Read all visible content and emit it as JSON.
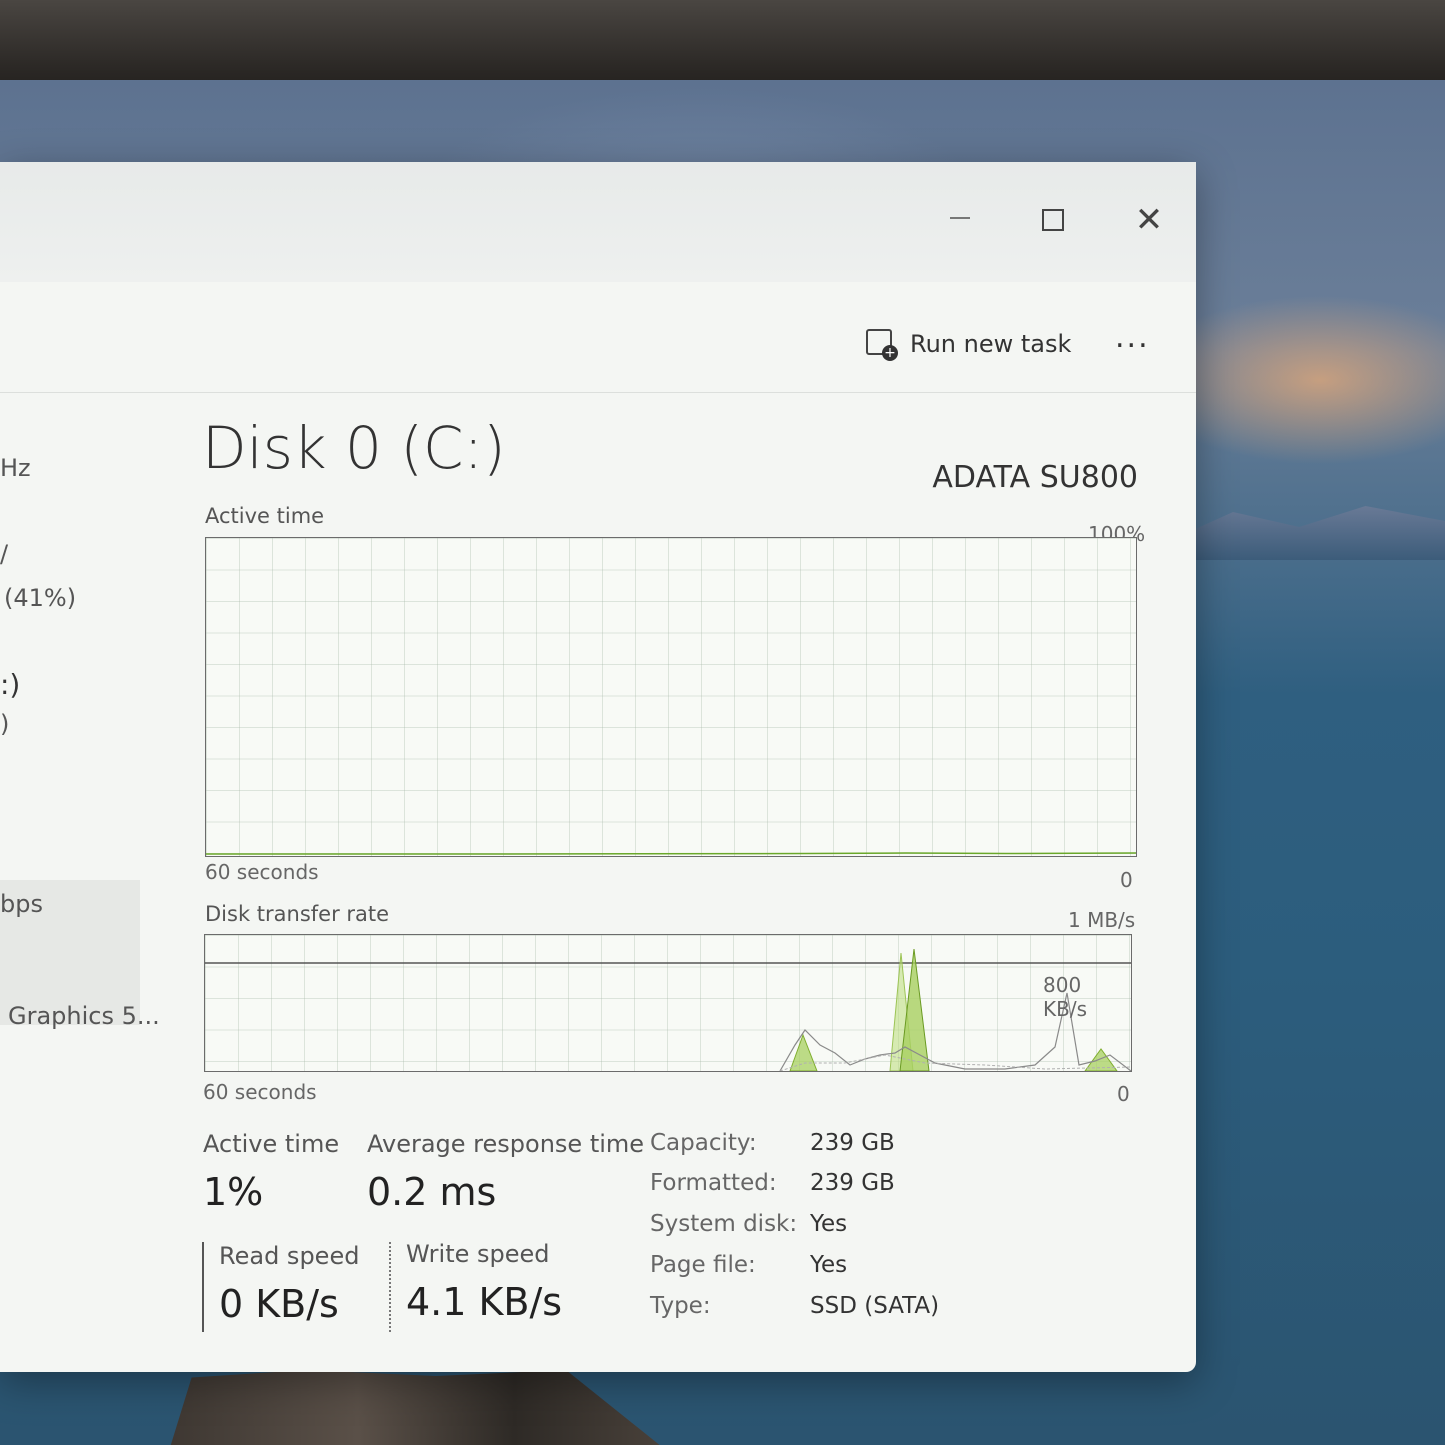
{
  "window": {
    "toolbar": {
      "run_new_task": "Run new task",
      "more": "..."
    }
  },
  "sidebar": {
    "items": [
      {
        "line1": "Hz"
      },
      {
        "line1": "/",
        "line2": "(41%)"
      },
      {
        "line1": ":)",
        "line2": ")",
        "selected": true
      },
      {
        "line1": "bps"
      },
      {
        "line1": "Graphics 5..."
      }
    ]
  },
  "disk": {
    "title": "Disk 0 (C:)",
    "model": "ADATA SU800",
    "active_time_graph": {
      "label": "Active time",
      "max_label": "100%",
      "time_label": "60 seconds",
      "min_label": "0"
    },
    "transfer_graph": {
      "label": "Disk transfer rate",
      "max_label": "1 MB/s",
      "mid_label": "800 KB/s",
      "time_label": "60 seconds",
      "min_label": "0"
    },
    "stats": {
      "active_time_label": "Active time",
      "active_time_value": "1%",
      "avg_response_label": "Average response time",
      "avg_response_value": "0.2 ms",
      "read_speed_label": "Read speed",
      "read_speed_value": "0 KB/s",
      "write_speed_label": "Write speed",
      "write_speed_value": "4.1 KB/s"
    },
    "properties": [
      {
        "key": "Capacity:",
        "value": "239 GB"
      },
      {
        "key": "Formatted:",
        "value": "239 GB"
      },
      {
        "key": "System disk:",
        "value": "Yes"
      },
      {
        "key": "Page file:",
        "value": "Yes"
      },
      {
        "key": "Type:",
        "value": "SSD (SATA)"
      }
    ]
  },
  "colors": {
    "graph_line": "#6b6b6b",
    "write_fill": "#a8d060",
    "read_line": "#8a8a8a"
  }
}
